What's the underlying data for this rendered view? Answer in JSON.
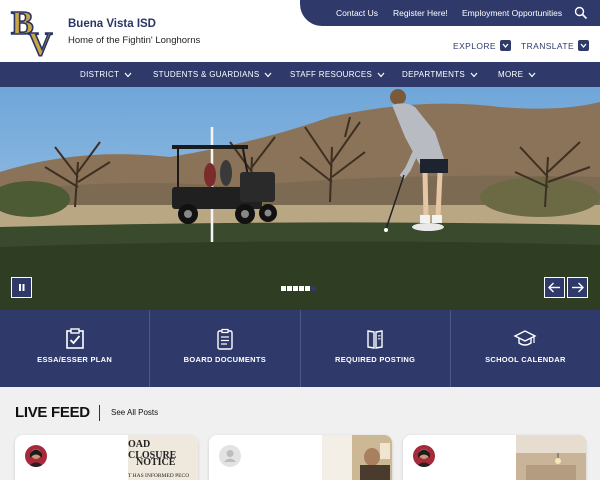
{
  "header": {
    "school_name": "Buena Vista ISD",
    "tagline": "Home of the Fightin' Longhorns",
    "logo_text": "BV"
  },
  "utility_links": {
    "contact": "Contact Us",
    "register": "Register Here!",
    "employment": "Employment Opportunities"
  },
  "sub_links": {
    "explore": "EXPLORE",
    "translate": "TRANSLATE"
  },
  "nav": {
    "items": [
      {
        "label": "DISTRICT"
      },
      {
        "label": "STUDENTS & GUARDIANS"
      },
      {
        "label": "STAFF RESOURCES"
      },
      {
        "label": "DEPARTMENTS"
      },
      {
        "label": "MORE"
      }
    ]
  },
  "hero": {
    "slide_count": 6,
    "active_slide": 6
  },
  "quick_links": [
    {
      "label": "ESSA/ESSER PLAN",
      "icon": "checklist-icon"
    },
    {
      "label": "BOARD DOCUMENTS",
      "icon": "clipboard-icon"
    },
    {
      "label": "REQUIRED POSTING",
      "icon": "book-icon"
    },
    {
      "label": "SCHOOL CALENDAR",
      "icon": "graduation-cap-icon"
    }
  ],
  "feed": {
    "title": "LIVE FEED",
    "see_all": "See All Posts",
    "card1_notice_line1": "OAD CLOSURE",
    "card1_notice_line2": "NOTICE",
    "card1_notice_line3": "T HAS INFORMED PECO"
  },
  "colors": {
    "navy": "#2f3a6b",
    "gold": "#c9a646",
    "background": "#f0f0f0"
  }
}
